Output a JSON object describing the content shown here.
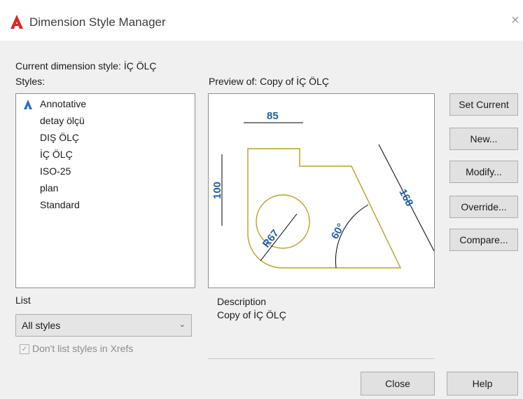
{
  "window": {
    "title": "Dimension Style Manager",
    "close_glyph": "×"
  },
  "current_style": {
    "label": "Current dimension style: İÇ ÖLÇ"
  },
  "styles": {
    "label": "Styles:",
    "items": [
      "Annotative",
      "detay ölçü",
      "DIŞ ÖLÇ",
      "İÇ ÖLÇ",
      "ISO-25",
      "plan",
      "Standard"
    ]
  },
  "preview": {
    "label": "Preview of: Copy of İÇ ÖLÇ",
    "dims": {
      "horizontal": "85",
      "vertical": "100",
      "aligned": "168",
      "radius": "R67",
      "angle": "60°"
    }
  },
  "description": {
    "label": "Description",
    "text": "Copy of İÇ ÖLÇ"
  },
  "list": {
    "label": "List",
    "selected": "All styles",
    "arrow": "⌄"
  },
  "xrefs": {
    "label": "Don't list styles in Xrefs",
    "checked": true,
    "check_glyph": "✓"
  },
  "buttons": {
    "set_current": "Set Current",
    "new": "New...",
    "modify": "Modify...",
    "override": "Override...",
    "compare": "Compare...",
    "close": "Close",
    "help": "Help"
  },
  "colors": {
    "geometry": "#b5a02a",
    "dim_text": "#1f5fa8",
    "app_icon": "#d62a2a"
  }
}
